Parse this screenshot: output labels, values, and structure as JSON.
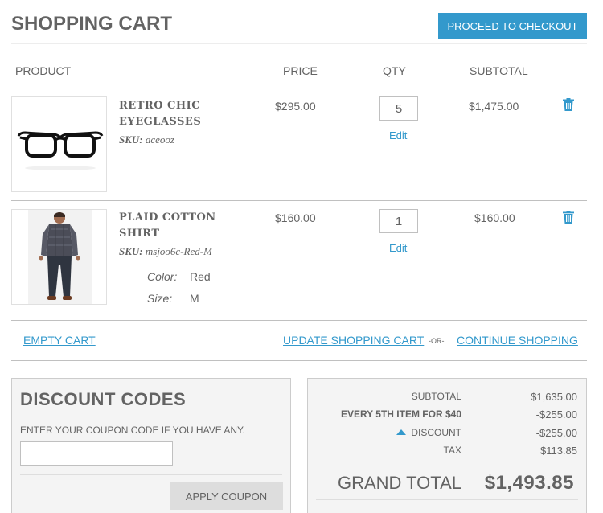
{
  "header": {
    "title": "SHOPPING CART",
    "checkout_label": "PROCEED TO CHECKOUT"
  },
  "table": {
    "columns": [
      "PRODUCT",
      "PRICE",
      "QTY",
      "SUBTOTAL"
    ]
  },
  "items": [
    {
      "name_line1": "RETRO CHIC",
      "name_line2": "EYEGLASSES",
      "sku_label": "SKU:",
      "sku": "aceooz",
      "price": "$295.00",
      "qty": "5",
      "edit_label": "Edit",
      "subtotal": "$1,475.00"
    },
    {
      "name_line1": "PLAID COTTON",
      "name_line2": "SHIRT",
      "sku_label": "SKU:",
      "sku": "msjoo6c-Red-M",
      "options": [
        {
          "label": "Color:",
          "value": "Red"
        },
        {
          "label": "Size:",
          "value": "M"
        }
      ],
      "price": "$160.00",
      "qty": "1",
      "edit_label": "Edit",
      "subtotal": "$160.00"
    }
  ],
  "actions": {
    "empty_cart": "EMPTY CART",
    "update_cart": "UPDATE SHOPPING CART",
    "or": "-OR-",
    "continue_shopping": "CONTINUE SHOPPING"
  },
  "discount": {
    "title": "DISCOUNT CODES",
    "hint": "ENTER YOUR COUPON CODE IF YOU HAVE ANY.",
    "input_value": "",
    "apply_label": "APPLY COUPON"
  },
  "totals": {
    "subtotal_label": "SUBTOTAL",
    "subtotal_value": "$1,635.00",
    "promo_label": "EVERY 5TH ITEM FOR $40",
    "promo_value": "-$255.00",
    "discount_label": "DISCOUNT",
    "discount_value": "-$255.00",
    "tax_label": "TAX",
    "tax_value": "$113.85",
    "grand_total_label": "GRAND TOTAL",
    "grand_total_value": "$1,493.85"
  },
  "colors": {
    "accent": "#3399cc",
    "text": "#636363",
    "panel": "#f4f4f4"
  },
  "icons": {
    "delete": "trash-icon",
    "toggle": "caret-up-icon"
  }
}
